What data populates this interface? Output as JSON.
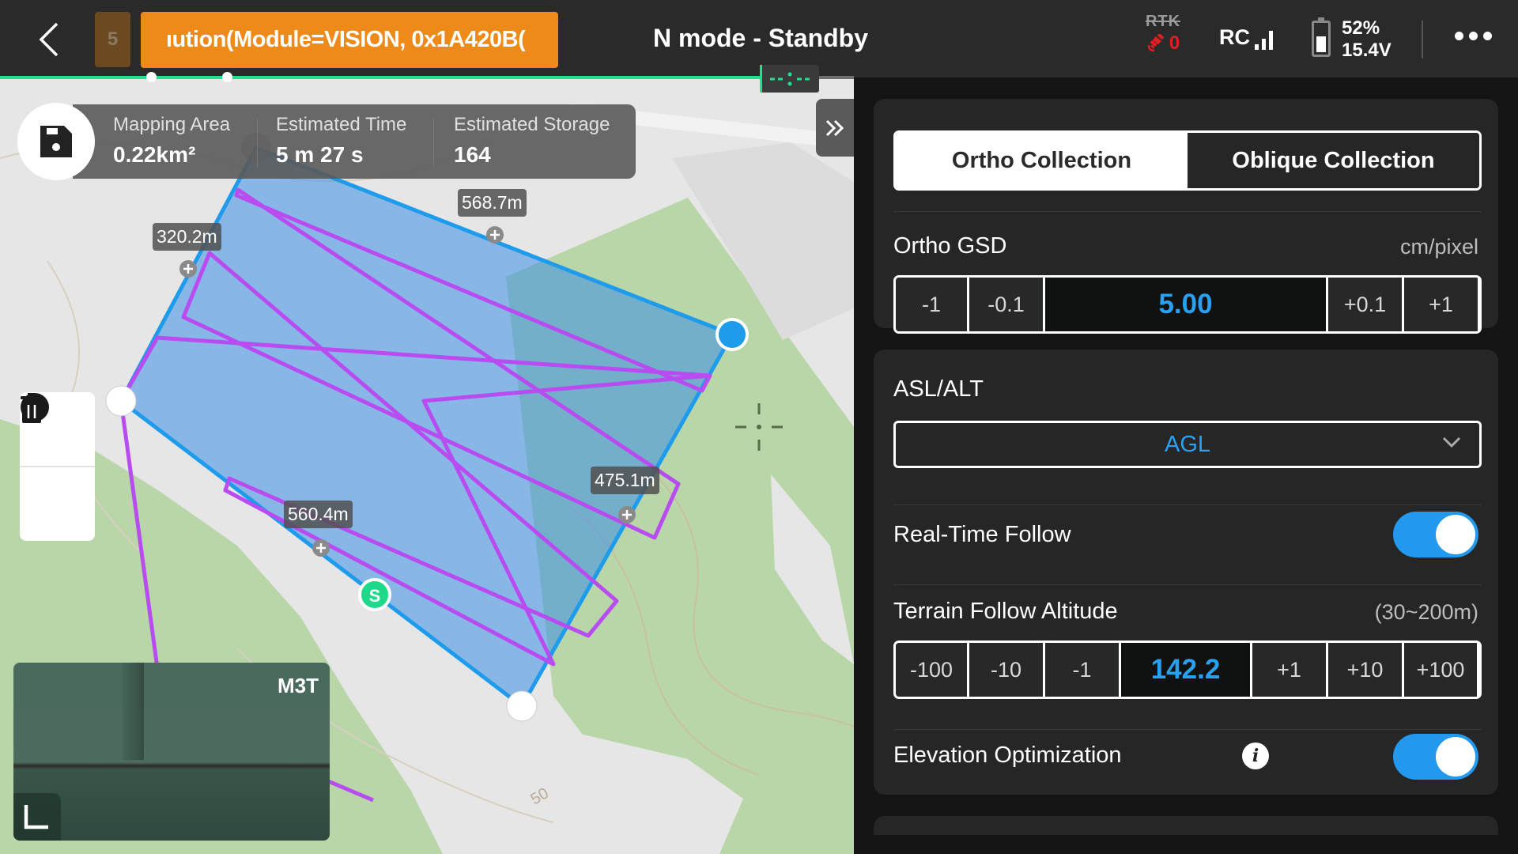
{
  "topbar": {
    "back_icon": "chevron-left-icon",
    "warning_count": "5",
    "warning_text": "ıution(Module=VISION, 0x1A420B(",
    "mode_title": "N mode - Standby",
    "rtk_label": "RTK",
    "satellite_count": "0",
    "rc_label": "RC",
    "rc_signal_bars": 3,
    "battery_percent": "52%",
    "battery_percent_value": 52,
    "battery_voltage": "15.4V",
    "more_icon": "more-horizontal-icon",
    "colors": {
      "warning": "#ee8a1a",
      "progress": "#1fe08e",
      "sat_error": "#e02020"
    }
  },
  "map": {
    "summary": {
      "mapping_area_label": "Mapping Area",
      "mapping_area_value": "0.22km²",
      "estimated_time_label": "Estimated Time",
      "estimated_time_value": "5 m 27 s",
      "estimated_storage_label": "Estimated Storage",
      "estimated_storage_value": "164"
    },
    "edge_lengths": [
      "320.2m",
      "568.7m",
      "475.1m",
      "560.4m"
    ],
    "start_marker": "S",
    "contour_label": "50",
    "camera_preview": {
      "name": "M3T"
    },
    "colors": {
      "boundary": "#1e9bea",
      "route": "#b84cf0",
      "fill": "#3a8ee8",
      "green_area": "#b9d6a8"
    }
  },
  "panel": {
    "tabs": [
      {
        "label": "Ortho Collection",
        "active": true
      },
      {
        "label": "Oblique Collection",
        "active": false
      }
    ],
    "ortho_gsd": {
      "label": "Ortho GSD",
      "unit": "cm/pixel",
      "buttons_minus": [
        "-1",
        "-0.1"
      ],
      "value": "5.00",
      "buttons_plus": [
        "+0.1",
        "+1"
      ]
    },
    "asl_alt": {
      "label": "ASL/ALT",
      "selected": "AGL"
    },
    "real_time_follow": {
      "label": "Real-Time Follow",
      "enabled": true
    },
    "terrain_follow_altitude": {
      "label": "Terrain Follow Altitude",
      "range": "(30~200m)",
      "buttons_minus": [
        "-100",
        "-10",
        "-1"
      ],
      "value": "142.2",
      "buttons_plus": [
        "+1",
        "+10",
        "+100"
      ]
    },
    "elevation_optimization": {
      "label": "Elevation Optimization",
      "info_icon": "i",
      "enabled": true
    },
    "accent": "#2aa0f0"
  }
}
